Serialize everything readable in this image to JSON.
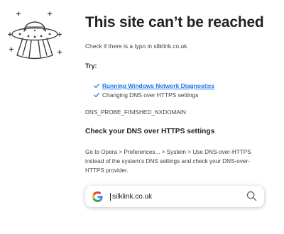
{
  "error": {
    "title": "This site can’t be reached",
    "typo_message": "Check if there is a typo in silklink.co.uk.",
    "try_label": "Try:",
    "suggestions": [
      {
        "label": "Running Windows Network Diagnostics",
        "is_link": true
      },
      {
        "label": "Changing DNS over HTTPS settings",
        "is_link": false
      }
    ],
    "error_code": "DNS_PROBE_FINISHED_NXDOMAIN"
  },
  "dns_help": {
    "title": "Check your DNS over HTTPS settings",
    "description": "Go to Opera > Preferences... > System > Use DNS-over-HTTPS instead of the system’s DNS settings and check your DNS-over-HTTPS provider."
  },
  "search": {
    "value": "silklink.co.uk",
    "engine_icon": "google-logo-icon",
    "action_icon": "search-icon"
  },
  "icons": {
    "illustration": "ufo-illustration-icon",
    "check": "checkmark-icon"
  },
  "colors": {
    "link": "#1a73e8",
    "check": "#1a73e8",
    "text": "#202124"
  }
}
